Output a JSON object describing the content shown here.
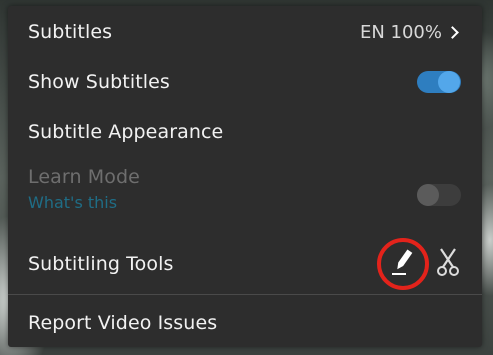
{
  "menu": {
    "subtitles": {
      "label": "Subtitles",
      "value": "EN 100%"
    },
    "show_subtitles": {
      "label": "Show Subtitles",
      "enabled": true
    },
    "subtitle_appearance": {
      "label": "Subtitle Appearance"
    },
    "learn_mode": {
      "label": "Learn Mode",
      "link": "What's this",
      "enabled": false
    },
    "subtitling_tools": {
      "label": "Subtitling Tools",
      "icons": [
        "pen-icon",
        "scissors-icon"
      ]
    },
    "report": {
      "label": "Report Video Issues"
    }
  },
  "colors": {
    "panel": "#2d2d2d",
    "toggle_on": "#2e7ec0",
    "link": "#1f6d86",
    "highlight": "#e3231b"
  }
}
